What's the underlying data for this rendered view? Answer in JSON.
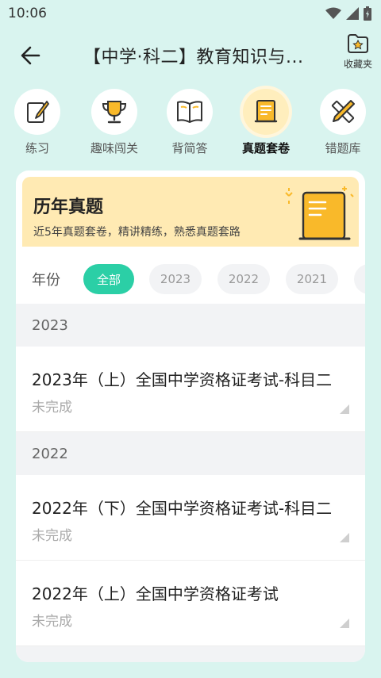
{
  "status_bar": {
    "time": "10:06"
  },
  "header": {
    "title": "【中学·科二】教育知识与...",
    "favorites_label": "收藏夹"
  },
  "tabs": [
    {
      "label": "练习",
      "icon": "edit-note-icon",
      "active": false
    },
    {
      "label": "趣味闯关",
      "icon": "trophy-icon",
      "active": false
    },
    {
      "label": "背简答",
      "icon": "book-icon",
      "active": false
    },
    {
      "label": "真题套卷",
      "icon": "scroll-icon",
      "active": true
    },
    {
      "label": "错题库",
      "icon": "pencil-ruler-icon",
      "active": false
    }
  ],
  "banner": {
    "title": "历年真题",
    "subtitle": "近5年真题套卷，精讲精练，熟悉真题套路"
  },
  "filter": {
    "label": "年份",
    "chips": [
      {
        "label": "全部",
        "active": true
      },
      {
        "label": "2023",
        "active": false
      },
      {
        "label": "2022",
        "active": false
      },
      {
        "label": "2021",
        "active": false
      }
    ]
  },
  "sections": [
    {
      "year": "2023",
      "items": [
        {
          "title": "2023年（上）全国中学资格证考试-科目二",
          "status": "未完成"
        }
      ]
    },
    {
      "year": "2022",
      "items": [
        {
          "title": "2022年（下）全国中学资格证考试-科目二",
          "status": "未完成"
        },
        {
          "title": "2022年（上）全国中学资格证考试",
          "status": "未完成"
        }
      ]
    }
  ],
  "colors": {
    "background": "#d9f4ef",
    "accent": "#2bcfa6",
    "banner": "#ffeab3",
    "icon_yellow": "#f9b92a"
  }
}
